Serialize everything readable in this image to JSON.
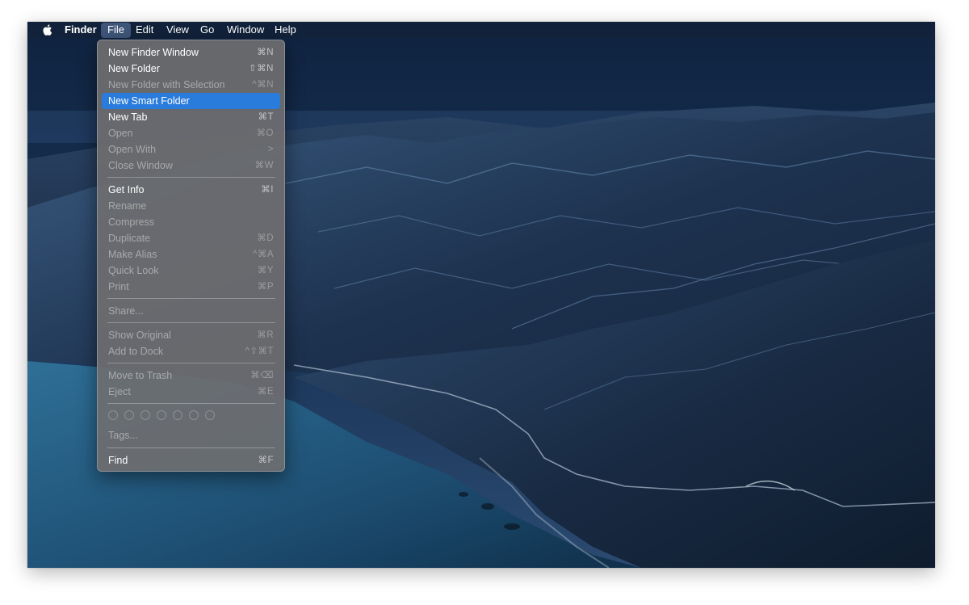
{
  "menubar": {
    "apple_icon": "apple-logo-icon",
    "items": [
      {
        "label": "Finder",
        "bold": true
      },
      {
        "label": "File",
        "active": true
      },
      {
        "label": "Edit"
      },
      {
        "label": "View"
      },
      {
        "label": "Go"
      },
      {
        "label": "Window"
      },
      {
        "label": "Help"
      }
    ]
  },
  "file_menu": {
    "items": [
      {
        "label": "New Finder Window",
        "shortcut": "⌘N",
        "enabled": true
      },
      {
        "label": "New Folder",
        "shortcut": "⇧⌘N",
        "enabled": true
      },
      {
        "label": "New Folder with Selection",
        "shortcut": "^⌘N",
        "enabled": false
      },
      {
        "label": "New Smart Folder",
        "shortcut": "",
        "enabled": true,
        "highlighted": true
      },
      {
        "label": "New Tab",
        "shortcut": "⌘T",
        "enabled": true
      },
      {
        "label": "Open",
        "shortcut": "⌘O",
        "enabled": false
      },
      {
        "label": "Open With",
        "shortcut": ">",
        "enabled": false
      },
      {
        "label": "Close Window",
        "shortcut": "⌘W",
        "enabled": false
      },
      {
        "label": "Get Info",
        "shortcut": "⌘I",
        "enabled": true
      },
      {
        "label": "Rename",
        "shortcut": "",
        "enabled": false
      },
      {
        "label": "Compress",
        "shortcut": "",
        "enabled": false
      },
      {
        "label": "Duplicate",
        "shortcut": "⌘D",
        "enabled": false
      },
      {
        "label": "Make Alias",
        "shortcut": "^⌘A",
        "enabled": false
      },
      {
        "label": "Quick Look",
        "shortcut": "⌘Y",
        "enabled": false
      },
      {
        "label": "Print",
        "shortcut": "⌘P",
        "enabled": false
      },
      {
        "label": "Share...",
        "shortcut": "",
        "enabled": false
      },
      {
        "label": "Show Original",
        "shortcut": "⌘R",
        "enabled": false
      },
      {
        "label": "Add to Dock",
        "shortcut": "^⇧⌘T",
        "enabled": false
      },
      {
        "label": "Move to Trash",
        "shortcut": "⌘⌫",
        "enabled": false
      },
      {
        "label": "Eject",
        "shortcut": "⌘E",
        "enabled": false
      },
      {
        "label": "Tags...",
        "shortcut": "",
        "enabled": false
      },
      {
        "label": "Find",
        "shortcut": "⌘F",
        "enabled": true
      }
    ],
    "tag_color_count": 7
  },
  "colors": {
    "highlight": "#2a7cdc",
    "menu_bg": "#6e6e70",
    "wallpaper_sky": "#17324f",
    "wallpaper_sea": "#2d6a8f"
  }
}
